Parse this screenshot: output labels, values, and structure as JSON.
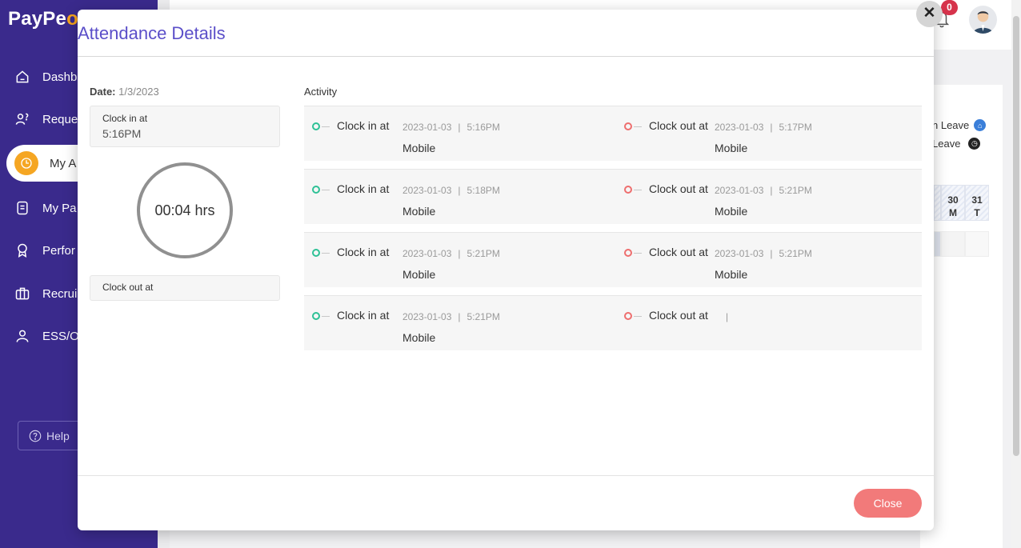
{
  "app": {
    "logo_main": "PayPe",
    "logo_accent": "o"
  },
  "sidebar": {
    "items": [
      {
        "label": "Dashb",
        "icon": "home-icon"
      },
      {
        "label": "Reque",
        "icon": "request-icon"
      },
      {
        "label": "My A",
        "icon": "clock-icon"
      },
      {
        "label": "My Pa",
        "icon": "document-icon"
      },
      {
        "label": "Perfor",
        "icon": "award-icon"
      },
      {
        "label": "Recrui",
        "icon": "briefcase-icon"
      },
      {
        "label": "ESS/O",
        "icon": "person-icon"
      }
    ],
    "help_label": "Help"
  },
  "header": {
    "notification_count": "0"
  },
  "background": {
    "legend": [
      {
        "label": "n Leave",
        "color": "#3b7fd9"
      },
      {
        "label": "Leave",
        "color": "#222222"
      }
    ],
    "calendar_days": [
      {
        "num": "30",
        "day": "M"
      },
      {
        "num": "31",
        "day": "T"
      }
    ]
  },
  "modal": {
    "title": "Attendance Details",
    "date_label": "Date:",
    "date_value": "1/3/2023",
    "clock_in_label": "Clock in at",
    "clock_in_time": "5:16PM",
    "duration": "00:04 hrs",
    "clock_out_label": "Clock out at",
    "activity_title": "Activity",
    "activity": [
      {
        "in_label": "Clock in at",
        "in_date": "2023-01-03",
        "in_sep": "|",
        "in_time": "5:16PM",
        "in_source": "Mobile",
        "out_label": "Clock out at",
        "out_date": "2023-01-03",
        "out_sep": "|",
        "out_time": "5:17PM",
        "out_source": "Mobile"
      },
      {
        "in_label": "Clock in at",
        "in_date": "2023-01-03",
        "in_sep": "|",
        "in_time": "5:18PM",
        "in_source": "Mobile",
        "out_label": "Clock out at",
        "out_date": "2023-01-03",
        "out_sep": "|",
        "out_time": "5:21PM",
        "out_source": "Mobile"
      },
      {
        "in_label": "Clock in at",
        "in_date": "2023-01-03",
        "in_sep": "|",
        "in_time": "5:21PM",
        "in_source": "Mobile",
        "out_label": "Clock out at",
        "out_date": "2023-01-03",
        "out_sep": "|",
        "out_time": "5:21PM",
        "out_source": "Mobile"
      },
      {
        "in_label": "Clock in at",
        "in_date": "2023-01-03",
        "in_sep": "|",
        "in_time": "5:21PM",
        "in_source": "Mobile",
        "out_label": "Clock out at",
        "out_date": "",
        "out_sep": "|",
        "out_time": "",
        "out_source": ""
      }
    ],
    "close_button": "Close",
    "close_icon": "close-icon"
  }
}
